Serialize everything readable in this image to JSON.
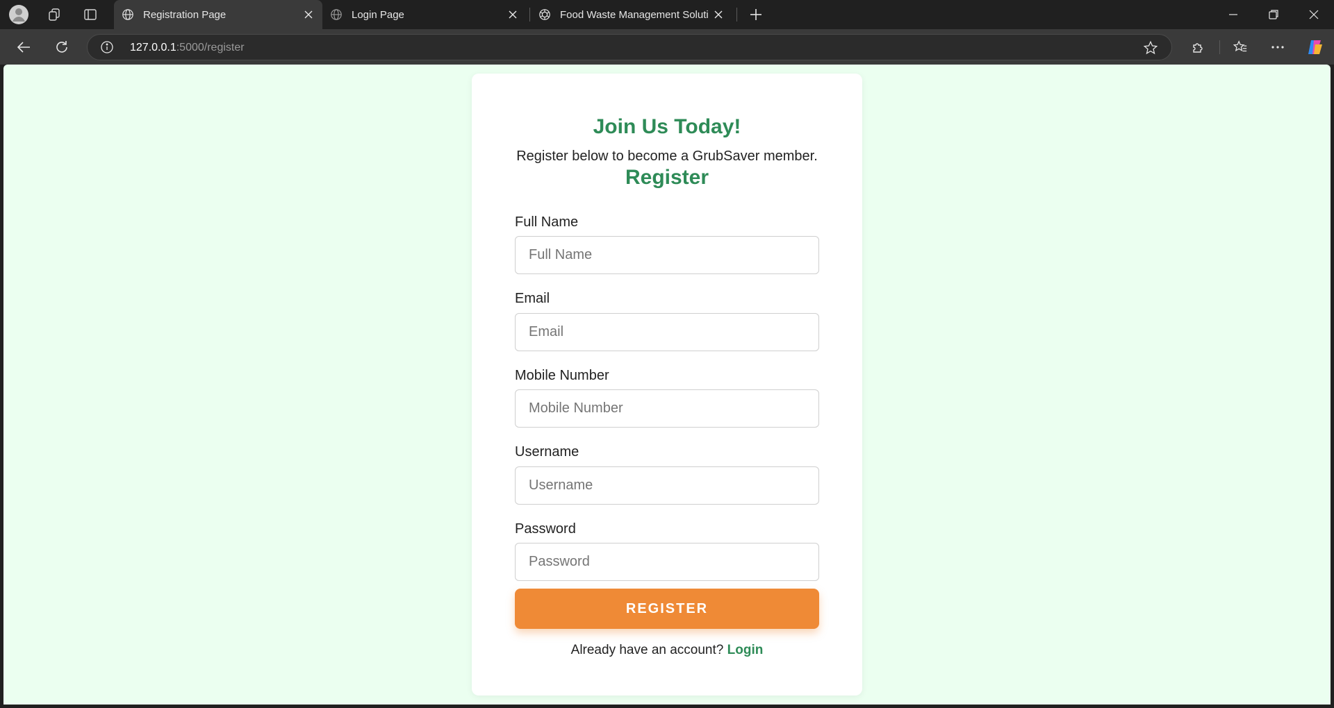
{
  "browser": {
    "tabs": [
      {
        "title": "Registration Page",
        "active": true,
        "icon": "globe-icon"
      },
      {
        "title": "Login Page",
        "active": false,
        "icon": "globe-icon"
      },
      {
        "title": "Food Waste Management Solutio",
        "active": false,
        "icon": "openai-icon"
      }
    ],
    "address": {
      "host": "127.0.0.1",
      "rest": ":5000/register"
    }
  },
  "page": {
    "hero_title": "Join Us Today!",
    "hero_subtitle": "Register below to become a GrubSaver member.",
    "form_title": "Register",
    "fields": [
      {
        "label": "Full Name",
        "placeholder": "Full Name",
        "value": ""
      },
      {
        "label": "Email",
        "placeholder": "Email",
        "value": ""
      },
      {
        "label": "Mobile Number",
        "placeholder": "Mobile Number",
        "value": ""
      },
      {
        "label": "Username",
        "placeholder": "Username",
        "value": ""
      },
      {
        "label": "Password",
        "placeholder": "Password",
        "value": ""
      }
    ],
    "submit_label": "REGISTER",
    "login_prompt": "Already have an account?",
    "login_link": "Login"
  },
  "colors": {
    "page_background": "#ebfff0",
    "accent_green": "#2e8b57",
    "button_orange": "#ef8a36"
  }
}
